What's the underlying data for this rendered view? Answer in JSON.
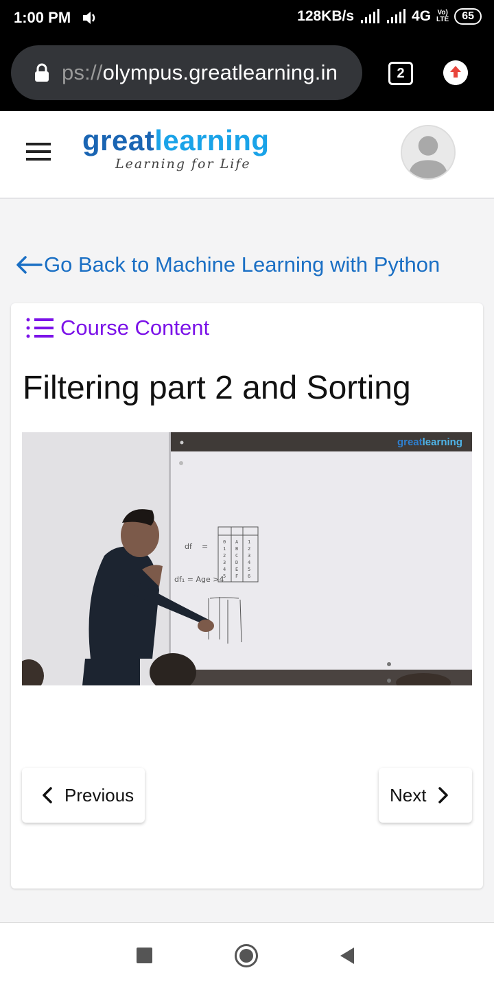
{
  "status_bar": {
    "time": "1:00 PM",
    "speed": "128KB/s",
    "network": "4G",
    "volte_top": "Vo)",
    "volte_bottom": "LTE",
    "battery": "65"
  },
  "browser": {
    "url_prefix": "ps://",
    "url_host": "olympus.greatlearning.in",
    "tab_count": "2",
    "update_color": "#e8453c"
  },
  "header": {
    "logo_great": "great",
    "logo_learning": "learning",
    "tagline": "Learning for Life"
  },
  "back_link": {
    "label": "Go Back to Machine Learning with Python"
  },
  "course": {
    "content_label": "Course Content",
    "lesson_title": "Filtering part 2 and Sorting",
    "video_watermark_great": "great",
    "video_watermark_learning": "learning"
  },
  "navigation": {
    "previous_label": "Previous",
    "next_label": "Next"
  },
  "colors": {
    "link_blue": "#1a6fc4",
    "accent_purple": "#7b12e8",
    "logo_dark_blue": "#1a65b3",
    "logo_light_blue": "#1aa3e8"
  },
  "icons": [
    "volume-icon",
    "signal-icon",
    "lock-icon",
    "arrow-up-icon",
    "hamburger-icon",
    "avatar-icon",
    "arrow-left-icon",
    "list-icon",
    "chevron-left-icon",
    "chevron-right-icon",
    "square-icon",
    "circle-icon",
    "triangle-back-icon"
  ]
}
